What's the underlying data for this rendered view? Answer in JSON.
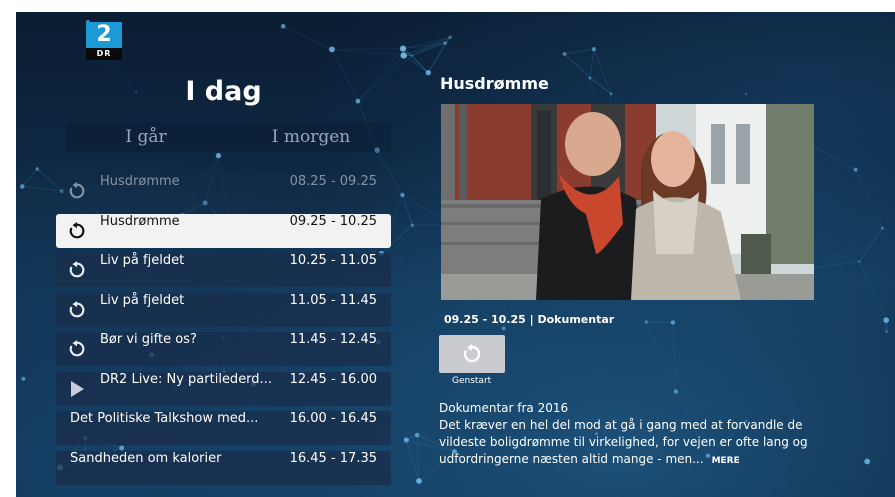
{
  "channel": {
    "logo_number": "2",
    "logo_text": "DR"
  },
  "schedule": {
    "day_title": "I dag",
    "prev_day": "I går",
    "next_day": "I morgen",
    "items": [
      {
        "title": "Husdrømme",
        "time": "08.25 - 09.25",
        "icon": "restart",
        "state": "faded"
      },
      {
        "title": "Husdrømme",
        "time": "09.25 - 10.25",
        "icon": "restart",
        "state": "selected"
      },
      {
        "title": "Liv på fjeldet",
        "time": "10.25 - 11.05",
        "icon": "restart",
        "state": "normal"
      },
      {
        "title": "Liv på fjeldet",
        "time": "11.05 - 11.45",
        "icon": "restart",
        "state": "normal"
      },
      {
        "title": "Bør vi gifte os?",
        "time": "11.45 - 12.45",
        "icon": "restart",
        "state": "normal"
      },
      {
        "title": "DR2 Live: Ny partilederd...",
        "time": "12.45 - 16.00",
        "icon": "play",
        "state": "normal"
      },
      {
        "title": "Det Politiske Talkshow med...",
        "time": "16.00 - 16.45",
        "icon": "none",
        "state": "normal"
      },
      {
        "title": "Sandheden om kalorier",
        "time": "16.45 - 17.35",
        "icon": "none",
        "state": "normal"
      }
    ]
  },
  "detail": {
    "title": "Husdrømme",
    "meta": "09.25 - 10.25 | Dokumentar",
    "restart_label": "Genstart",
    "description_heading": "Dokumentar fra 2016",
    "description": "Det kræver en hel del mod at gå i gang med at forvandle de vildeste boligdrømme til virkelighed, for vejen er ofte lang og udfordringerne næsten altid mange - men...",
    "more_label": "MERE"
  },
  "colors": {
    "accent_blue": "#1b9ad6",
    "selected_row": "#f2f2f2",
    "row_bg": "#192d4b",
    "background": "#0b1d33"
  }
}
